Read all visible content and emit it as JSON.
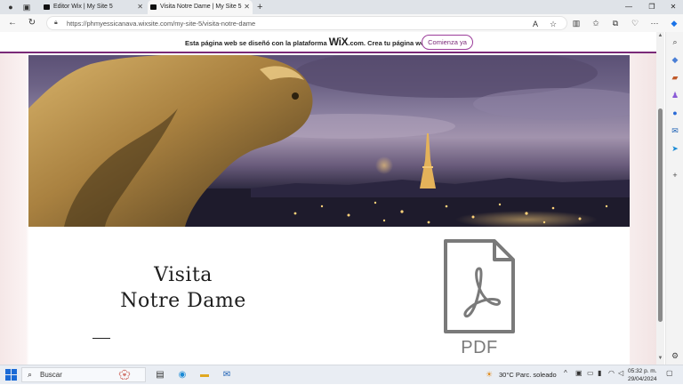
{
  "browser": {
    "tabs": [
      {
        "title": "Editor Wix | My Site 5"
      },
      {
        "title": "Visita Notre Dame | My Site 5"
      }
    ],
    "url": "https://phmyessicanava.wixsite.com/my-site-5/visita-notre-dame"
  },
  "wix_banner": {
    "text_before": "Esta página web se diseñó con la plataforma ",
    "logo": "WiX",
    "text_after": ".com. Crea tu página web hoy.",
    "button": "Comienza ya"
  },
  "page": {
    "heading_line1": "Visita",
    "heading_line2": "Notre Dame",
    "pdf_label": "PDF"
  },
  "taskbar": {
    "search_placeholder": "Buscar",
    "weather": "30°C  Parc. soleado",
    "time": "05:32 p. m.",
    "date": "29/04/2024"
  },
  "colors": {
    "wix_accent": "#7a2a78",
    "pdf_gray": "#7a7a7a"
  }
}
